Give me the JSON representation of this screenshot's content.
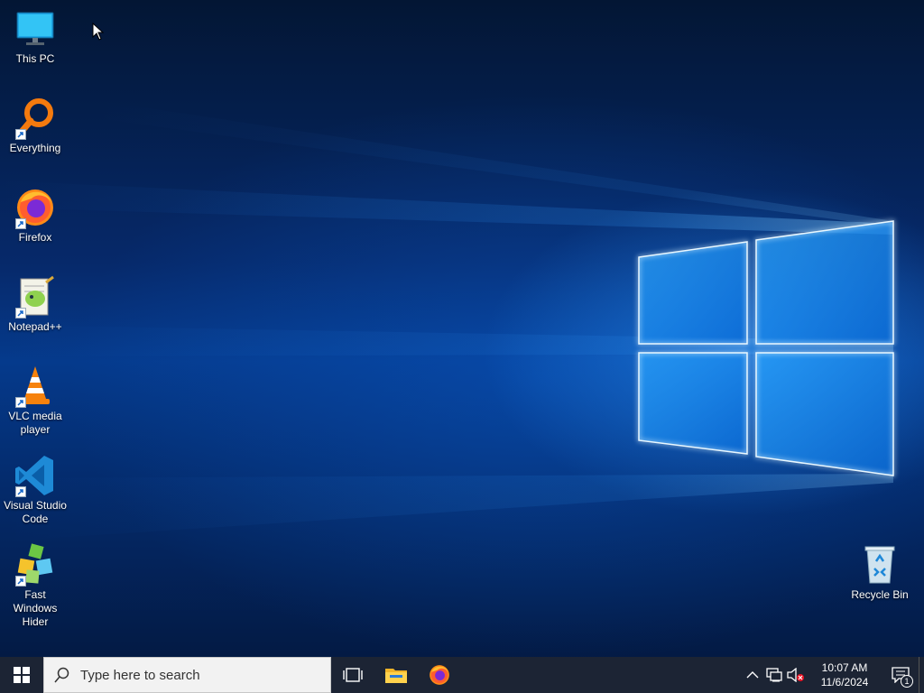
{
  "desktop": {
    "icons": [
      {
        "label": "This PC",
        "icon": "monitor-icon",
        "shortcut": false
      },
      {
        "label": "Everything",
        "icon": "magnifier-icon",
        "shortcut": true
      },
      {
        "label": "Firefox",
        "icon": "firefox-icon",
        "shortcut": true
      },
      {
        "label": "Notepad++",
        "icon": "notepadpp-icon",
        "shortcut": true
      },
      {
        "label": "VLC media player",
        "icon": "vlc-cone-icon",
        "shortcut": true
      },
      {
        "label": "Visual Studio Code",
        "icon": "vscode-icon",
        "shortcut": true
      },
      {
        "label": "Fast Windows Hider",
        "icon": "cubes-icon",
        "shortcut": true
      }
    ],
    "recycle_bin": {
      "label": "Recycle Bin",
      "icon": "recycle-bin-icon"
    }
  },
  "taskbar": {
    "search": {
      "placeholder": "Type here to search"
    },
    "pinned": [
      "task-view-icon",
      "file-explorer-icon",
      "firefox-icon"
    ],
    "tray": {
      "icons": [
        "chevron-up-icon",
        "network-icon",
        "volume-muted-icon"
      ],
      "time": "10:07 AM",
      "date": "11/6/2024",
      "notification_count": "1"
    }
  },
  "colors": {
    "taskbar": "#1c2434",
    "accent_blue": "#0a78d7",
    "text": "#ffffff"
  }
}
